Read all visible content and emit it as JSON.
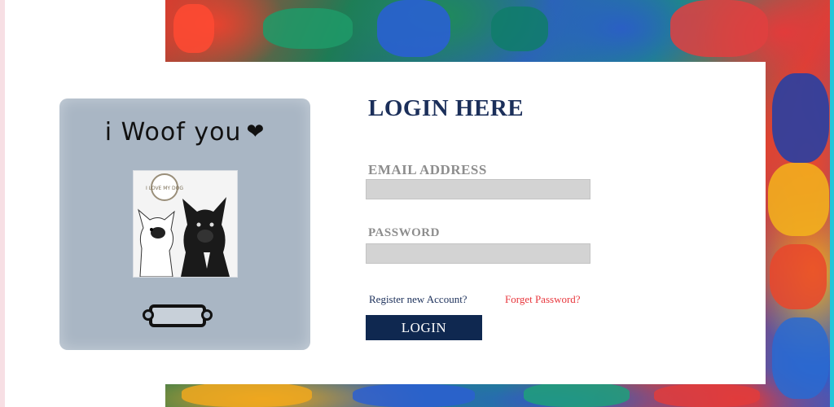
{
  "frame": {
    "caption": "i Woof you",
    "heart_icon": "heart-paw-icon",
    "photo_icon": "dogs-photo",
    "badge_text": "I LOVE MY DOG"
  },
  "form": {
    "title": "LOGIN HERE",
    "email_label": "EMAIL ADDRESS",
    "email_value": "",
    "password_label": "PASSWORD",
    "password_value": "",
    "register_link": "Register new Account?",
    "forgot_link": "Forget Password?",
    "login_button": "LOGIN"
  },
  "colors": {
    "title": "#1b2f5a",
    "label": "#8d8d8d",
    "input_bg": "#d3d3d3",
    "button_bg": "#0f2850",
    "forgot_link": "#e8373d",
    "register_link": "#1b2f5a",
    "frame": "#a9b6c4"
  }
}
